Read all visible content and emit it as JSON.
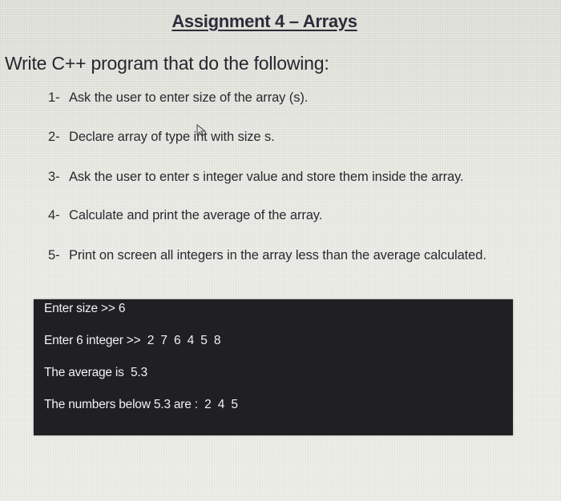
{
  "title": "Assignment 4 – Arrays",
  "intro": "Write C++ program that do the following:",
  "steps": [
    {
      "number": "1-",
      "text": "Ask the user to enter size of the array (s)."
    },
    {
      "number": "2-",
      "text": "Declare array of type int with size s."
    },
    {
      "number": "3-",
      "text": "Ask the user to enter s integer value and store them inside the array."
    },
    {
      "number": "4-",
      "text": "Calculate and print the average of the array."
    },
    {
      "number": "5-",
      "text": "Print on screen all integers in the array less than the average calculated."
    }
  ],
  "console": {
    "lines": [
      "Enter size >> 6",
      "Enter 6 integer >>  2  7  6  4  5  8",
      "The average is  5.3",
      "The numbers below 5.3 are :  2  4  5"
    ]
  },
  "colors": {
    "background": "#e6e6e0",
    "console_background": "#1f1f24",
    "console_text": "#f2f2f2"
  }
}
